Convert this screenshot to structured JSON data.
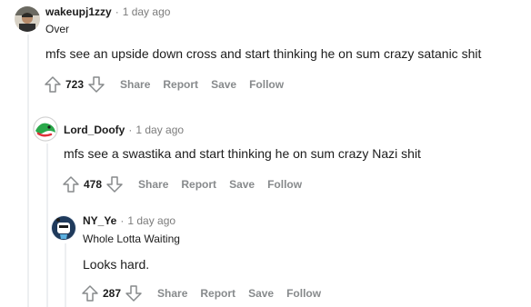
{
  "comments": [
    {
      "username": "wakeupj1zzy",
      "separator": "·",
      "time": "1 day ago",
      "flair": "Over",
      "body": "mfs see an upside down cross and start thinking he on sum crazy satanic shit",
      "score": "723",
      "actions": {
        "share": "Share",
        "report": "Report",
        "save": "Save",
        "follow": "Follow"
      }
    },
    {
      "username": "Lord_Doofy",
      "separator": "·",
      "time": "1 day ago",
      "body": "mfs see a swastika and start thinking he on sum crazy Nazi shit",
      "score": "478",
      "actions": {
        "share": "Share",
        "report": "Report",
        "save": "Save",
        "follow": "Follow"
      }
    },
    {
      "username": "NY_Ye",
      "separator": "·",
      "time": "1 day ago",
      "flair": "Whole Lotta Waiting",
      "body": "Looks hard.",
      "score": "287",
      "actions": {
        "share": "Share",
        "report": "Report",
        "save": "Save",
        "follow": "Follow"
      }
    }
  ],
  "icons": {
    "upvote": "upvote-arrow-icon",
    "downvote": "downvote-arrow-icon"
  },
  "colors": {
    "muted": "#878a8c",
    "text": "#1c1c1c",
    "thread_line": "#edeff1"
  }
}
